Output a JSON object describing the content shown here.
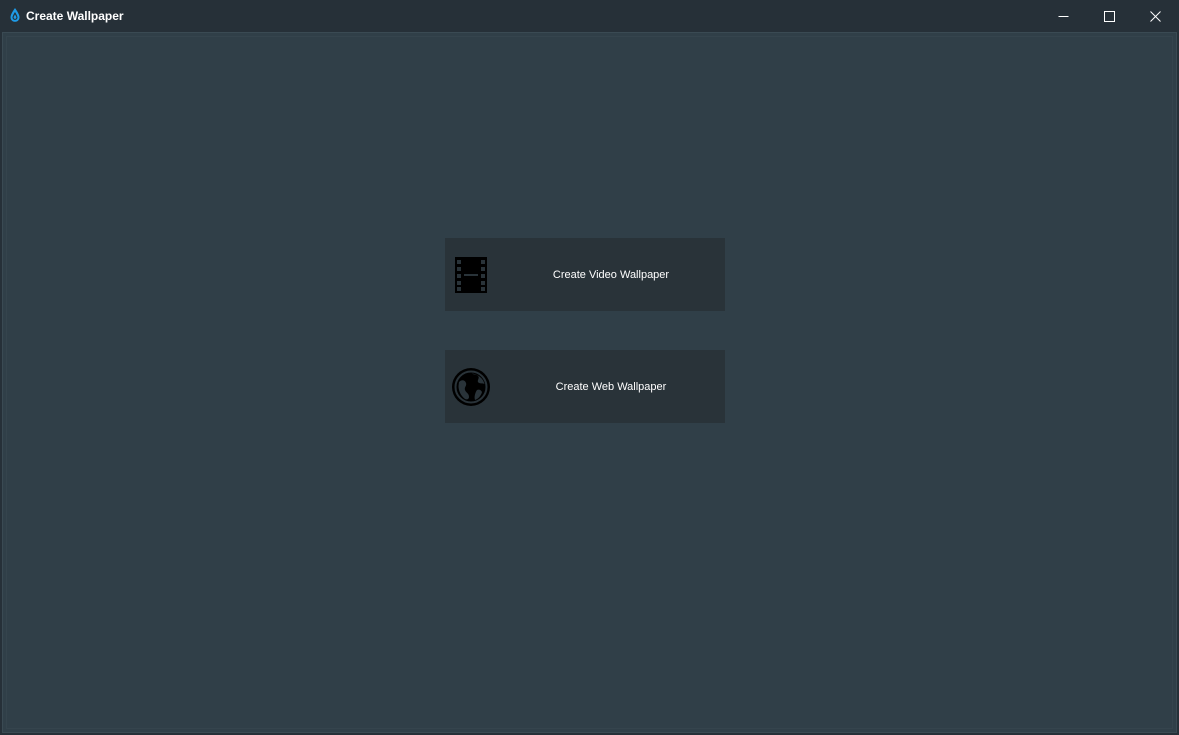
{
  "window": {
    "title": "Create Wallpaper",
    "icon": "droplet-icon",
    "controls": {
      "minimize": "minimize-icon",
      "maximize": "maximize-icon",
      "close": "close-icon"
    }
  },
  "actions": [
    {
      "label": "Create Video Wallpaper",
      "icon": "film-icon"
    },
    {
      "label": "Create Web Wallpaper",
      "icon": "globe-icon"
    }
  ],
  "colors": {
    "titlebar": "#263038",
    "content_bg": "#303f48",
    "button_bg": "#293339",
    "accent": "#1e9be8",
    "text": "#ffffff"
  }
}
